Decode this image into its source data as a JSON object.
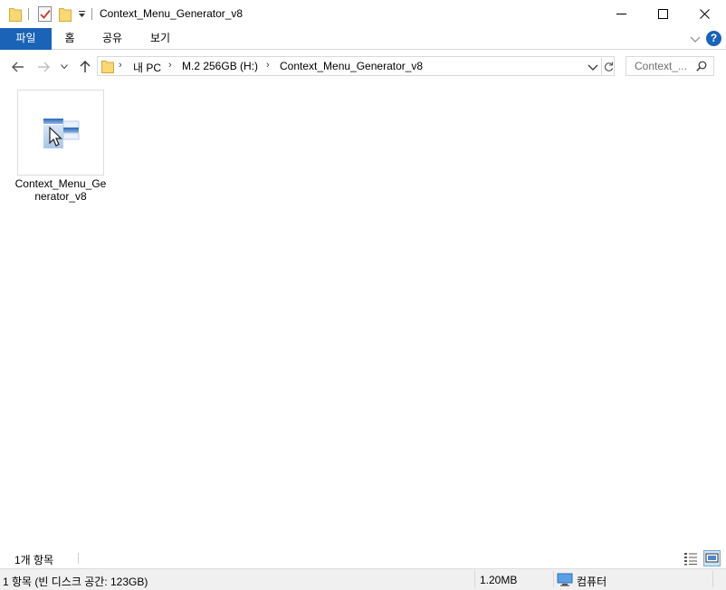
{
  "window": {
    "title": "Context_Menu_Generator_v8"
  },
  "ribbon": {
    "tabs": [
      {
        "label": "파일"
      },
      {
        "label": "홈"
      },
      {
        "label": "공유"
      },
      {
        "label": "보기"
      }
    ],
    "help_label": "?"
  },
  "address": {
    "breadcrumbs": [
      {
        "label": "내 PC"
      },
      {
        "label": "M.2 256GB (H:)"
      },
      {
        "label": "Context_Menu_Generator_v8"
      }
    ]
  },
  "search": {
    "placeholder": "Context_..."
  },
  "files": [
    {
      "name": "Context_Menu_Generator_v8",
      "icon": "application-icon"
    }
  ],
  "status": {
    "item_count": "1개 항목"
  },
  "infobar": {
    "summary": "1 항목 (빈 디스크 공간: 123GB)",
    "size": "1.20MB",
    "location": "컴퓨터"
  },
  "colors": {
    "accent": "#1a63b6",
    "folder": "#f8d775"
  }
}
